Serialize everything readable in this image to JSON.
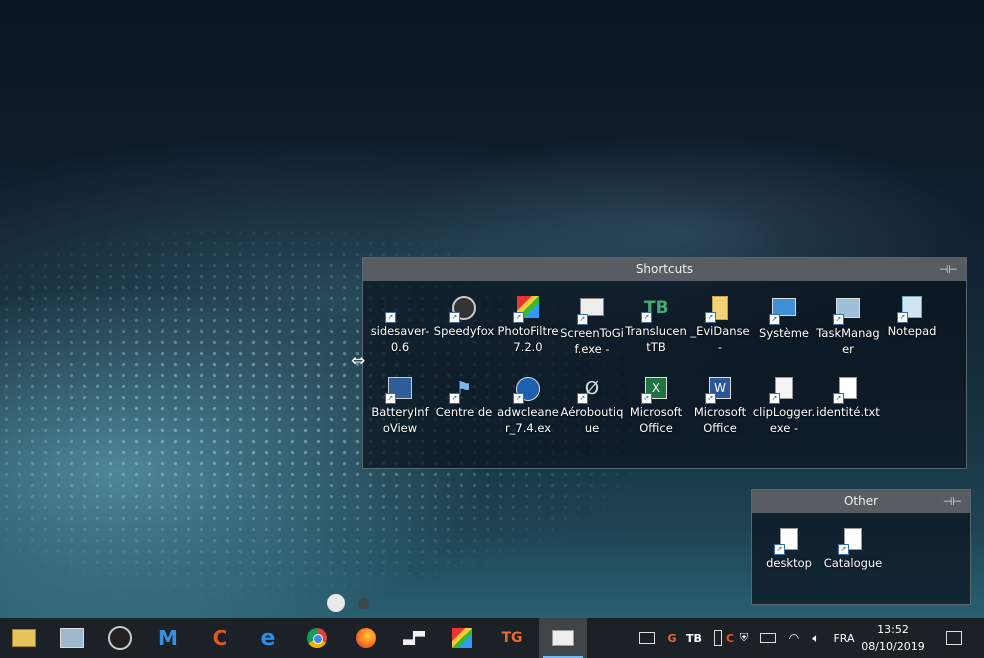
{
  "fences": {
    "shortcuts": {
      "title": "Shortcuts",
      "pin": "⊣⊢",
      "icons": [
        {
          "label": "sidesaver-0.6"
        },
        {
          "label": "Speedyfox"
        },
        {
          "label": "PhotoFiltre 7.2.0"
        },
        {
          "label": "ScreenToGif.exe -"
        },
        {
          "label": "TranslucentTB"
        },
        {
          "label": "_EviDanse -"
        },
        {
          "label": "Système"
        },
        {
          "label": "TaskManager"
        },
        {
          "label": "Notepad"
        },
        {
          "label": "BatteryInfoView"
        },
        {
          "label": "Centre de"
        },
        {
          "label": "adwcleaner_7.4.ex"
        },
        {
          "label": "Aéroboutique"
        },
        {
          "label": "Microsoft Office"
        },
        {
          "label": "Microsoft Office"
        },
        {
          "label": "clipLogger.exe -"
        },
        {
          "label": "identité.txt"
        }
      ]
    },
    "other": {
      "title": "Other",
      "pin": "⊣⊢",
      "icons": [
        {
          "label": "desktop"
        },
        {
          "label": "Catalogue"
        }
      ]
    }
  },
  "taskbar": {
    "apps": [
      "file-explorer",
      "sidesaver",
      "speedyfox",
      "malwarebytes",
      "ccleaner",
      "edge",
      "chrome",
      "firefox",
      "app-black",
      "photofiltre",
      "tg-app",
      "screentogif"
    ],
    "tray": {
      "language": "FRA",
      "time": "13:52",
      "date": "08/10/2019"
    }
  },
  "colors": {
    "accent": "#76b9ed",
    "fence_title": "#5f6469"
  }
}
